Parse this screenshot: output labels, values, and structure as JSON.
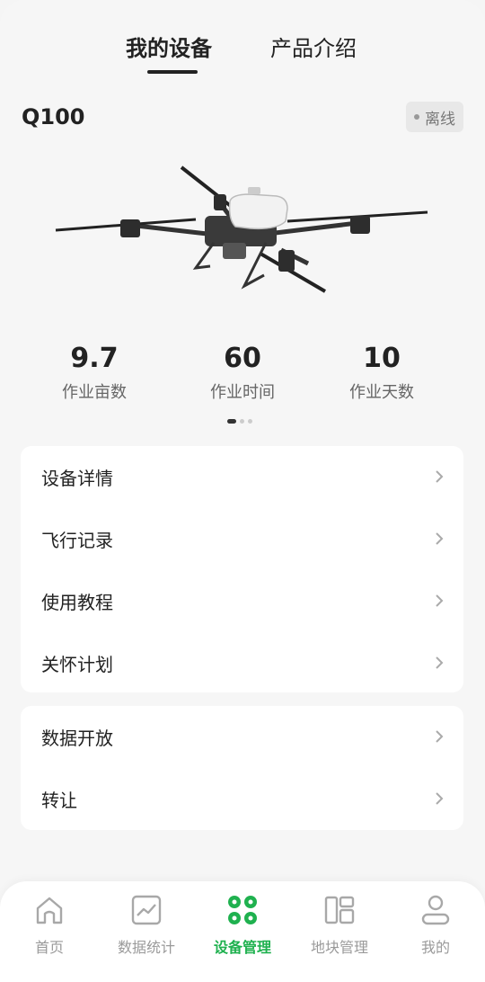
{
  "tabs": {
    "my_devices": "我的设备",
    "product_intro": "产品介绍"
  },
  "device": {
    "name": "Q100",
    "status": "离线"
  },
  "stats": [
    {
      "value": "9.7",
      "label": "作业亩数"
    },
    {
      "value": "60",
      "label": "作业时间"
    },
    {
      "value": "10",
      "label": "作业天数"
    }
  ],
  "menu_group_1": [
    "设备详情",
    "飞行记录",
    "使用教程",
    "关怀计划"
  ],
  "menu_group_2": [
    "数据开放",
    "转让"
  ],
  "bottom_nav": {
    "home": "首页",
    "stats": "数据统计",
    "device_mgmt": "设备管理",
    "field_mgmt": "地块管理",
    "mine": "我的"
  },
  "colors": {
    "accent_green": "#1fb14f",
    "background": "#f6f6f6"
  }
}
